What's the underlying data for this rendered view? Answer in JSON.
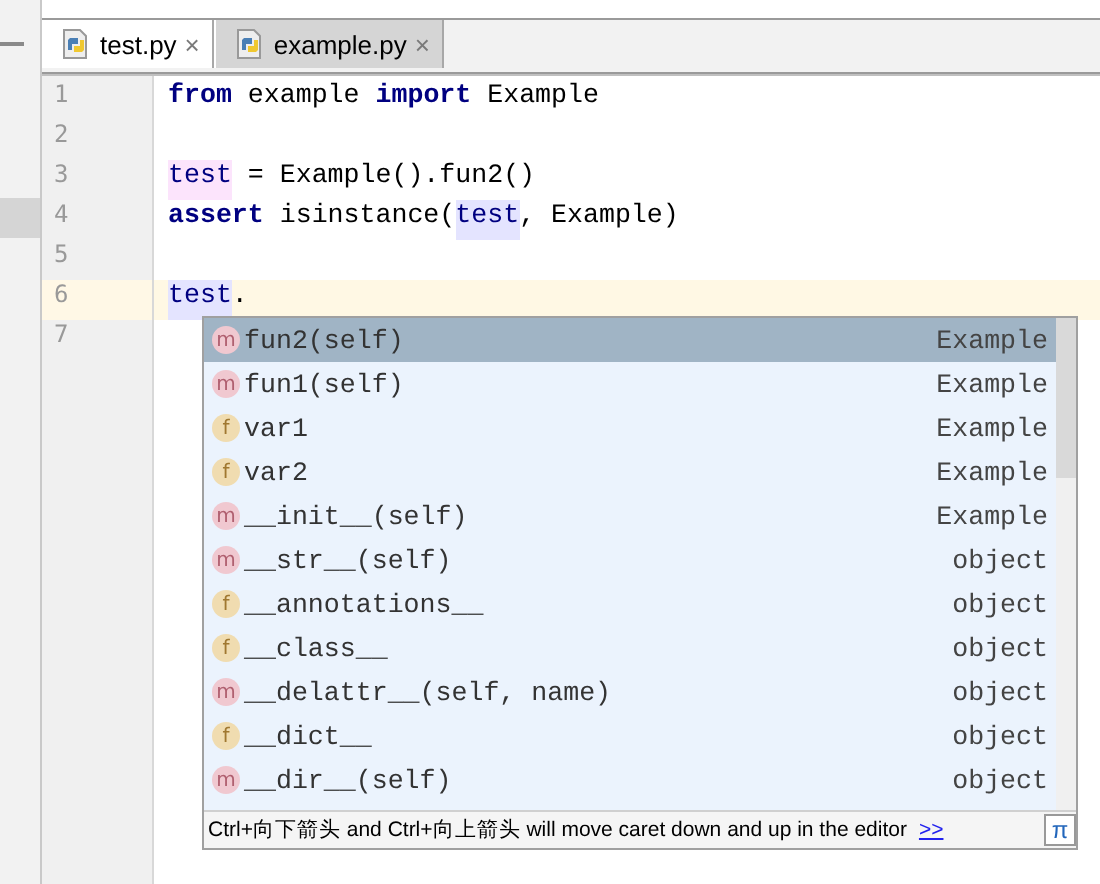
{
  "tabs": [
    {
      "label": "test.py",
      "close": "×",
      "selected": true
    },
    {
      "label": "example.py",
      "close": "×",
      "selected": false
    }
  ],
  "editor": {
    "lines": [
      {
        "number": "1",
        "current": false,
        "tokens": [
          {
            "kind": "keyword",
            "text": "from"
          },
          {
            "kind": "plain",
            "text": " example "
          },
          {
            "kind": "keyword",
            "text": "import"
          },
          {
            "kind": "plain",
            "text": " Example"
          }
        ]
      },
      {
        "number": "2",
        "current": false
      },
      {
        "number": "3",
        "current": false,
        "tokens": [
          {
            "kind": "write",
            "text": "test"
          },
          {
            "kind": "plain",
            "text": " = Example().fun2()"
          }
        ]
      },
      {
        "number": "4",
        "current": false,
        "tokens": [
          {
            "kind": "keyword",
            "text": "assert"
          },
          {
            "kind": "plain",
            "text": " isinstance("
          },
          {
            "kind": "read",
            "text": "test"
          },
          {
            "kind": "plain",
            "text": ", Example)"
          }
        ]
      },
      {
        "number": "5",
        "current": false
      },
      {
        "number": "6",
        "current": true,
        "tokens": [
          {
            "kind": "read",
            "text": "test"
          },
          {
            "kind": "plain",
            "text": "."
          }
        ]
      },
      {
        "number": "7",
        "current": false
      }
    ]
  },
  "completion": {
    "items": [
      {
        "icon": "m",
        "name": "fun2(self)",
        "type": "Example",
        "selected": true
      },
      {
        "icon": "m",
        "name": "fun1(self)",
        "type": "Example",
        "selected": false
      },
      {
        "icon": "f",
        "name": "var1",
        "type": "Example",
        "selected": false
      },
      {
        "icon": "f",
        "name": "var2",
        "type": "Example",
        "selected": false
      },
      {
        "icon": "m",
        "name": "__init__(self)",
        "type": "Example",
        "selected": false
      },
      {
        "icon": "m",
        "name": "__str__(self)",
        "type": "object",
        "selected": false
      },
      {
        "icon": "f",
        "name": "__annotations__",
        "type": "object",
        "selected": false
      },
      {
        "icon": "f",
        "name": "__class__",
        "type": "object",
        "selected": false
      },
      {
        "icon": "m",
        "name": "__delattr__(self, name)",
        "type": "object",
        "selected": false
      },
      {
        "icon": "f",
        "name": "__dict__",
        "type": "object",
        "selected": false
      },
      {
        "icon": "m",
        "name": "__dir__(self)",
        "type": "object",
        "selected": false
      }
    ],
    "hint": "Ctrl+向下箭头 and Ctrl+向上箭头 will move caret down and up in the editor",
    "hint_link": ">>",
    "pi_button": "π"
  }
}
